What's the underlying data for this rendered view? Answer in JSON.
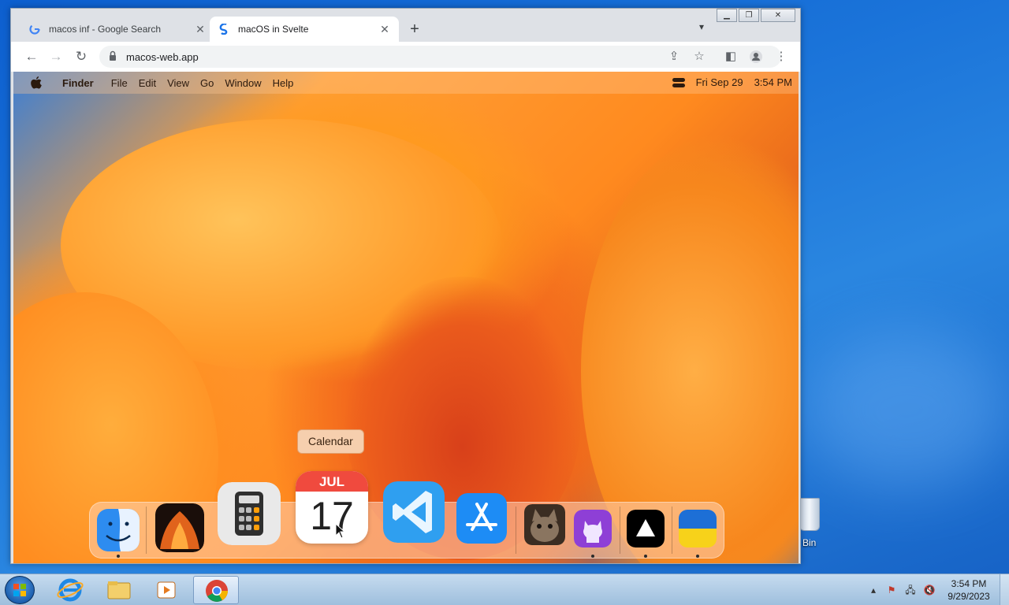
{
  "browser": {
    "tabs": [
      {
        "title": "macos inf - Google Search",
        "favicon": "google-icon",
        "active": false
      },
      {
        "title": "macOS in Svelte",
        "favicon": "svelte-icon",
        "active": true
      }
    ],
    "url": "macos-web.app"
  },
  "mac": {
    "menubar": {
      "app": "Finder",
      "items": [
        "File",
        "Edit",
        "View",
        "Go",
        "Window",
        "Help"
      ],
      "date": "Fri Sep 29",
      "time": "3:54 PM"
    },
    "tooltip": "Calendar",
    "calendar_icon": {
      "month": "JUL",
      "day": "17"
    },
    "dock": [
      {
        "name": "Finder",
        "icon": "finder-icon",
        "running": true
      },
      {
        "name": "Wallpapers",
        "icon": "wallpaper-icon",
        "running": false
      },
      {
        "name": "Calculator",
        "icon": "calculator-icon",
        "running": false
      },
      {
        "name": "Calendar",
        "icon": "calendar-icon",
        "running": false
      },
      {
        "name": "VS Code",
        "icon": "vscode-icon",
        "running": false
      },
      {
        "name": "App Store",
        "icon": "appstore-icon",
        "running": false
      },
      {
        "name": "Cat",
        "icon": "cat-icon",
        "running": false
      },
      {
        "name": "GitHub",
        "icon": "github-icon",
        "running": true
      },
      {
        "name": "Vercel",
        "icon": "vercel-icon",
        "running": true
      },
      {
        "name": "Ukraine",
        "icon": "ukraine-flag-icon",
        "running": true
      }
    ]
  },
  "windows": {
    "recycle_bin_label": "e Bin",
    "clock_time": "3:54 PM",
    "clock_date": "9/29/2023"
  }
}
